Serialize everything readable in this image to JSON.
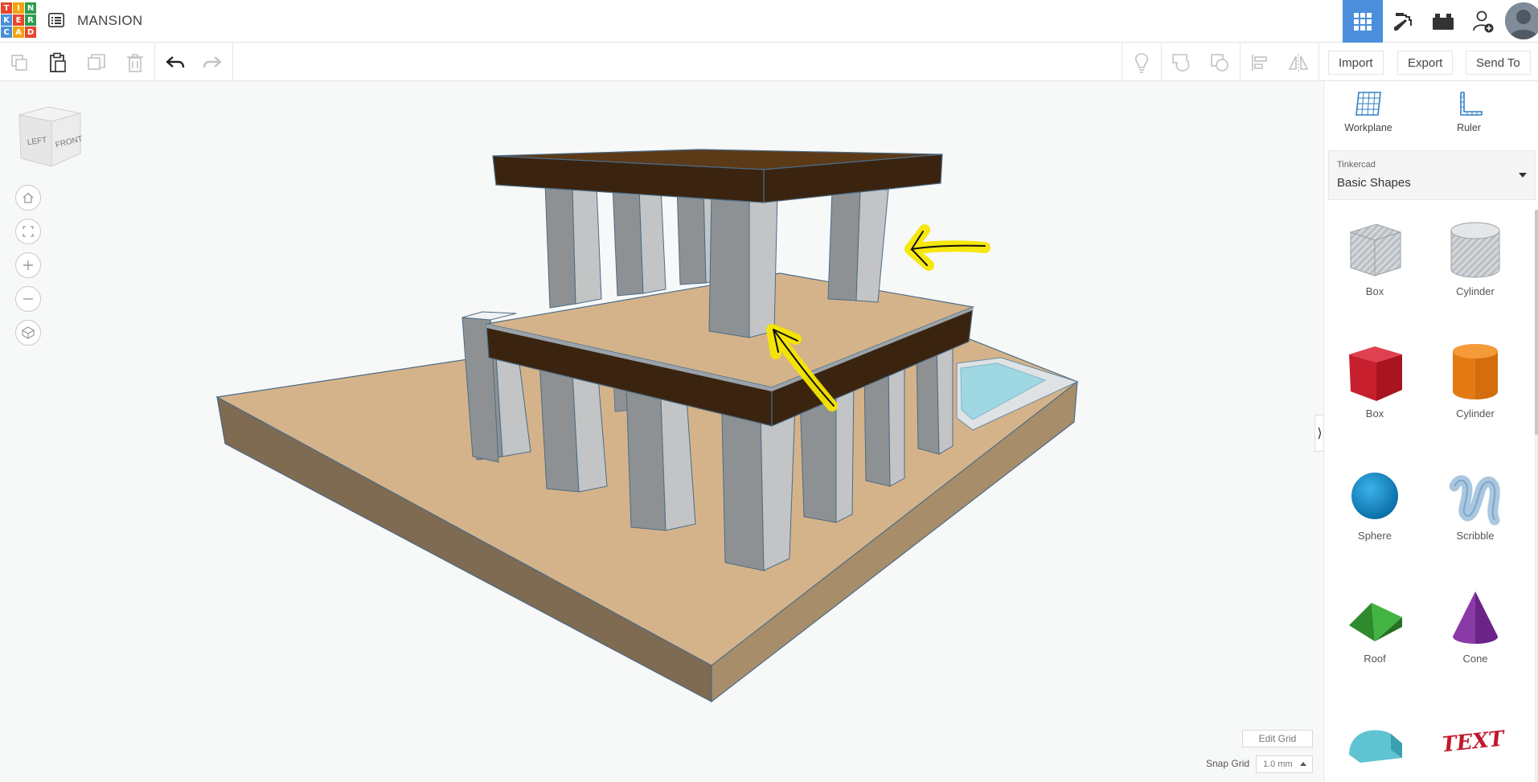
{
  "app": {
    "logo_letters": [
      "T",
      "I",
      "N",
      "K",
      "E",
      "R",
      "C",
      "A",
      "D"
    ],
    "logo_colors": [
      "#e8452c",
      "#f2a30f",
      "#2a9d4c",
      "#4a90d9",
      "#e8452c",
      "#2a9d4c",
      "#4a90d9",
      "#f2a30f",
      "#e8452c"
    ],
    "title": "MANSION"
  },
  "toolbar": {
    "import_label": "Import",
    "export_label": "Export",
    "send_to_label": "Send To"
  },
  "viewcube": {
    "left": "LEFT",
    "front": "FRONT"
  },
  "grid": {
    "edit_label": "Edit Grid",
    "snap_label": "Snap Grid",
    "snap_value": "1.0 mm"
  },
  "panel": {
    "workplane_label": "Workplane",
    "ruler_label": "Ruler",
    "library_source": "Tinkercad",
    "library_name": "Basic Shapes",
    "shapes": [
      {
        "label": "Box",
        "icon": "box-hole-icon"
      },
      {
        "label": "Cylinder",
        "icon": "cylinder-hole-icon"
      },
      {
        "label": "Box",
        "icon": "box-icon"
      },
      {
        "label": "Cylinder",
        "icon": "cylinder-icon"
      },
      {
        "label": "Sphere",
        "icon": "sphere-icon"
      },
      {
        "label": "Scribble",
        "icon": "scribble-icon"
      },
      {
        "label": "Roof",
        "icon": "roof-icon"
      },
      {
        "label": "Cone",
        "icon": "cone-icon"
      },
      {
        "label": "",
        "icon": "round-roof-icon"
      },
      {
        "label": "",
        "icon": "text-icon"
      }
    ],
    "text_shape_glyph": "TEXT"
  },
  "colors": {
    "accent": "#4b8fdc",
    "floor": "#d5b38a",
    "base_front": "#7f6a52",
    "roof": "#3a2410",
    "pillar_light": "#c2c4c6",
    "pillar_dark": "#8e9193",
    "pool": "#9fd7e3",
    "annotation": "#f5e600"
  }
}
